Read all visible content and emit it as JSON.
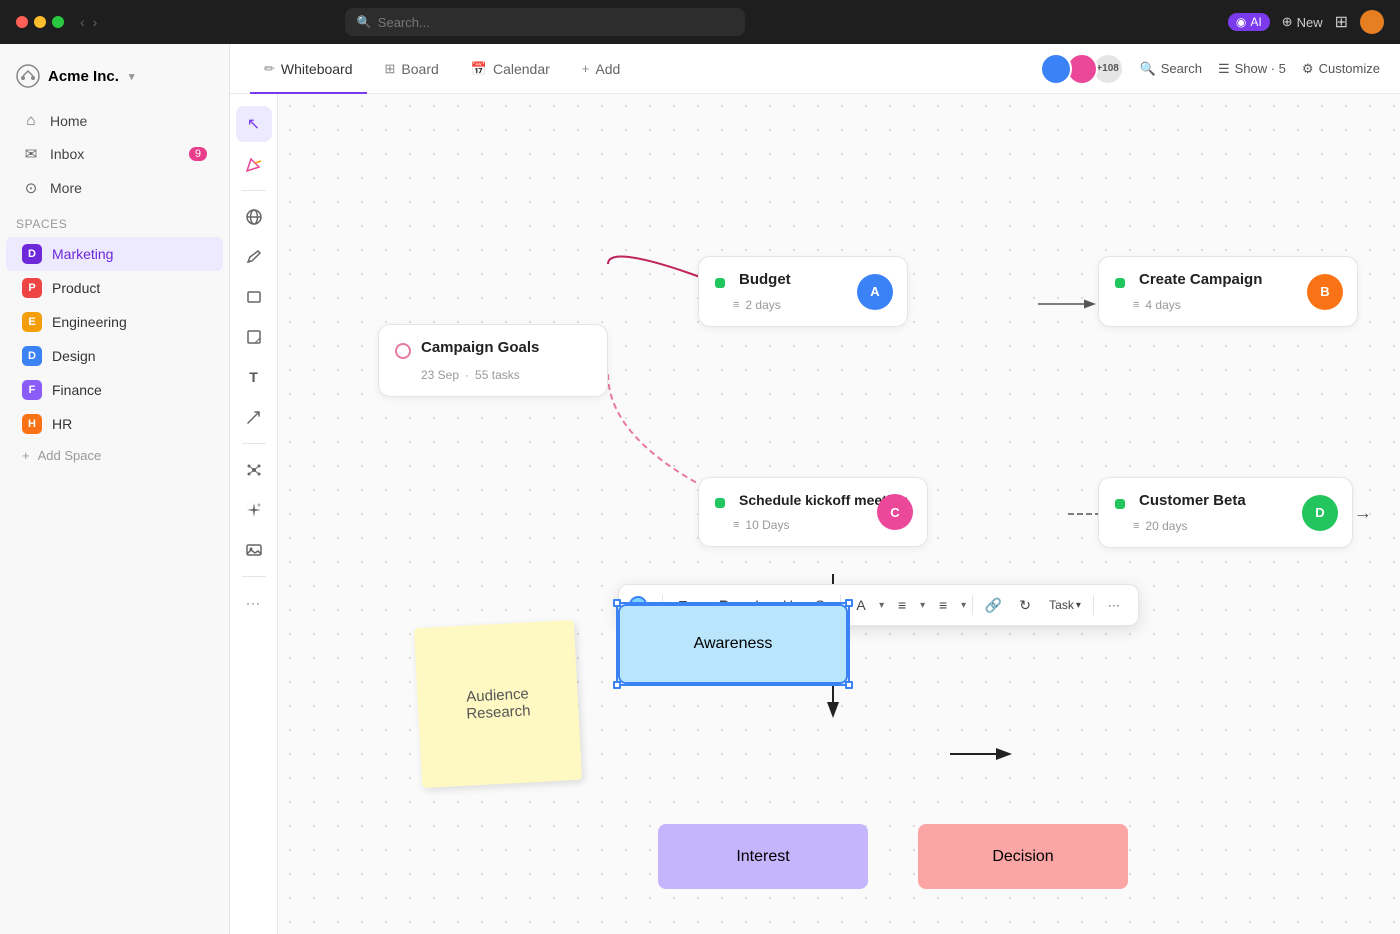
{
  "titlebar": {
    "search_placeholder": "Search...",
    "ai_label": "AI",
    "new_label": "New"
  },
  "sidebar": {
    "brand": "Acme Inc.",
    "nav": [
      {
        "id": "home",
        "label": "Home",
        "icon": "🏠"
      },
      {
        "id": "inbox",
        "label": "Inbox",
        "icon": "✉",
        "badge": "9"
      },
      {
        "id": "more",
        "label": "More",
        "icon": "⊙"
      }
    ],
    "spaces_label": "Spaces",
    "spaces": [
      {
        "id": "marketing",
        "label": "Marketing",
        "color": "#6d28d9",
        "letter": "D",
        "active": true
      },
      {
        "id": "product",
        "label": "Product",
        "color": "#ef4444",
        "letter": "P"
      },
      {
        "id": "engineering",
        "label": "Engineering",
        "color": "#f59e0b",
        "letter": "E"
      },
      {
        "id": "design",
        "label": "Design",
        "color": "#3b82f6",
        "letter": "D"
      },
      {
        "id": "finance",
        "label": "Finance",
        "color": "#8b5cf6",
        "letter": "F"
      },
      {
        "id": "hr",
        "label": "HR",
        "color": "#f97316",
        "letter": "H"
      }
    ],
    "add_space": "Add Space"
  },
  "topnav": {
    "tabs": [
      {
        "id": "whiteboard",
        "label": "Whiteboard",
        "icon": "✏",
        "active": true
      },
      {
        "id": "board",
        "label": "Board",
        "icon": "⊞"
      },
      {
        "id": "calendar",
        "label": "Calendar",
        "icon": "📅"
      },
      {
        "id": "add",
        "label": "Add",
        "icon": "+"
      }
    ],
    "actions": [
      {
        "id": "search",
        "label": "Search",
        "icon": "🔍"
      },
      {
        "id": "show",
        "label": "Show · 5",
        "icon": "☰"
      },
      {
        "id": "customize",
        "label": "Customize",
        "icon": "⚙"
      }
    ],
    "avatar_count": "+108"
  },
  "tools": [
    {
      "id": "select",
      "icon": "↖",
      "active": true
    },
    {
      "id": "color-picker",
      "icon": "🎨"
    },
    {
      "id": "globe",
      "icon": "🌐"
    },
    {
      "id": "pencil",
      "icon": "✏"
    },
    {
      "id": "rectangle",
      "icon": "⬜"
    },
    {
      "id": "sticky",
      "icon": "📝"
    },
    {
      "id": "text",
      "icon": "T"
    },
    {
      "id": "arrow",
      "icon": "↗"
    },
    {
      "id": "network",
      "icon": "⬡"
    },
    {
      "id": "sparkle",
      "icon": "✨"
    },
    {
      "id": "image",
      "icon": "🖼"
    },
    {
      "id": "more",
      "icon": "···"
    }
  ],
  "cards": {
    "campaign_goals": {
      "title": "Campaign Goals",
      "date": "23 Sep",
      "separator": "·",
      "tasks": "55 tasks"
    },
    "budget": {
      "title": "Budget",
      "days": "2 days"
    },
    "create_campaign": {
      "title": "Create Campaign",
      "days": "4 days"
    },
    "schedule_kickoff": {
      "title": "Schedule kickoff meeting",
      "days": "10 Days"
    },
    "customer_beta": {
      "title": "Customer Beta",
      "days": "20 days"
    }
  },
  "sticky": {
    "text": "Audience Research"
  },
  "flowboxes": {
    "awareness": "Awareness",
    "interest": "Interest",
    "decision": "Decision"
  },
  "toolbar": {
    "color_tool": "color",
    "text_size": "T",
    "bold": "B",
    "italic": "I",
    "underline": "U",
    "strikethrough": "S",
    "font_color": "A",
    "align": "≡",
    "list": "≡",
    "link": "🔗",
    "task": "Task",
    "more": "···"
  }
}
